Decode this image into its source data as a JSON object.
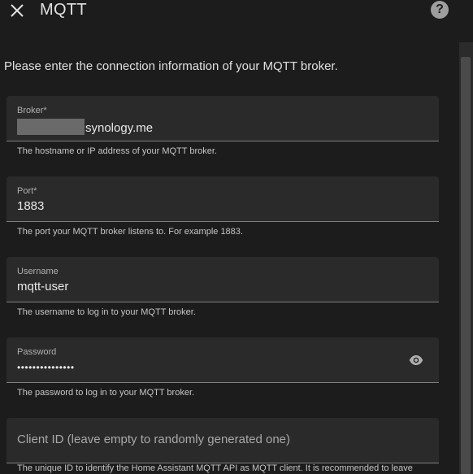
{
  "header": {
    "title": "MQTT",
    "help": "?"
  },
  "intro": "Please enter the connection information of your MQTT broker.",
  "fields": {
    "broker": {
      "label": "Broker*",
      "value": "synology.me",
      "helper": "The hostname or IP address of your MQTT broker."
    },
    "port": {
      "label": "Port*",
      "value": "1883",
      "helper": "The port your MQTT broker listens to. For example 1883."
    },
    "username": {
      "label": "Username",
      "value": "mqtt-user",
      "helper": "The username to log in to your MQTT broker."
    },
    "password": {
      "label": "Password",
      "value": "•••••••••••••••",
      "helper": "The password to log in to your MQTT broker."
    },
    "client_id": {
      "label": "Client ID (leave empty to randomly generated one)",
      "helper": "The unique ID to identify the Home Assistant MQTT API as MQTT client. It is recommended to leave"
    }
  },
  "icons": {
    "close": "close-icon",
    "help": "help-icon",
    "visibility": "eye-icon"
  },
  "colors": {
    "background": "#1c1c1c",
    "field_bg": "#2a2a2a",
    "text": "#e1e1e1"
  }
}
